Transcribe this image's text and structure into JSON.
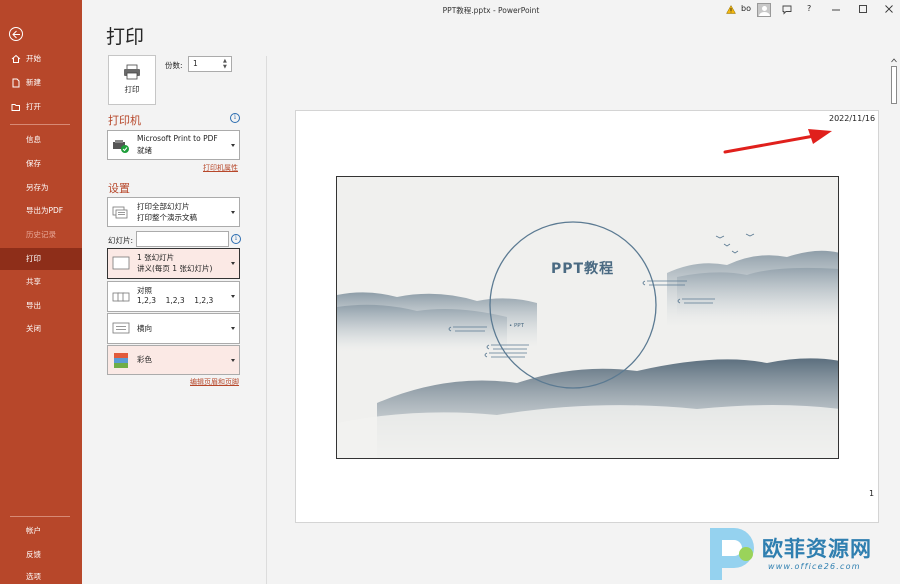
{
  "window": {
    "title": "PPT教程.pptx - PowerPoint",
    "user": "bo",
    "help": "?"
  },
  "sidebar": {
    "items": [
      {
        "label": "开始",
        "icon": "home-icon"
      },
      {
        "label": "新建",
        "icon": "new-file-icon"
      },
      {
        "label": "打开",
        "icon": "folder-open-icon"
      },
      {
        "label": "信息"
      },
      {
        "label": "保存"
      },
      {
        "label": "另存为"
      },
      {
        "label": "导出为PDF"
      },
      {
        "label": "历史记录"
      },
      {
        "label": "打印"
      },
      {
        "label": "共享"
      },
      {
        "label": "导出"
      },
      {
        "label": "关闭"
      },
      {
        "label": "帐户"
      },
      {
        "label": "反馈"
      },
      {
        "label": "选项"
      }
    ]
  },
  "print": {
    "page_title": "打印",
    "print_button": "打印",
    "copies_label": "份数:",
    "copies_value": "1",
    "printer_section": "打印机",
    "printer_name": "Microsoft Print to PDF",
    "printer_status": "就绪",
    "printer_properties": "打印机属性",
    "settings_section": "设置",
    "range_line1": "打印全部幻灯片",
    "range_line2": "打印整个演示文稿",
    "slides_label": "幻灯片:",
    "slides_value": "",
    "layout_line1": "1 张幻灯片",
    "layout_line2": "讲义(每页 1 张幻灯片)",
    "collate_line1": "对照",
    "collate_line2": "1,2,3    1,2,3    1,2,3",
    "orientation": "横向",
    "color": "彩色",
    "edit_header_footer": "编辑页眉和页脚"
  },
  "preview": {
    "date": "2022/11/16",
    "page_number": "1",
    "slide_title": "PPT教程",
    "slide_subtitle": "• PPT"
  },
  "watermark": {
    "text": "欧菲资源网",
    "url": "www.office26.com"
  },
  "colors": {
    "accent": "#b7472a",
    "accent_dark": "#8e2e19",
    "slide_text": "#4a6a82",
    "arrow": "#e0201c"
  }
}
